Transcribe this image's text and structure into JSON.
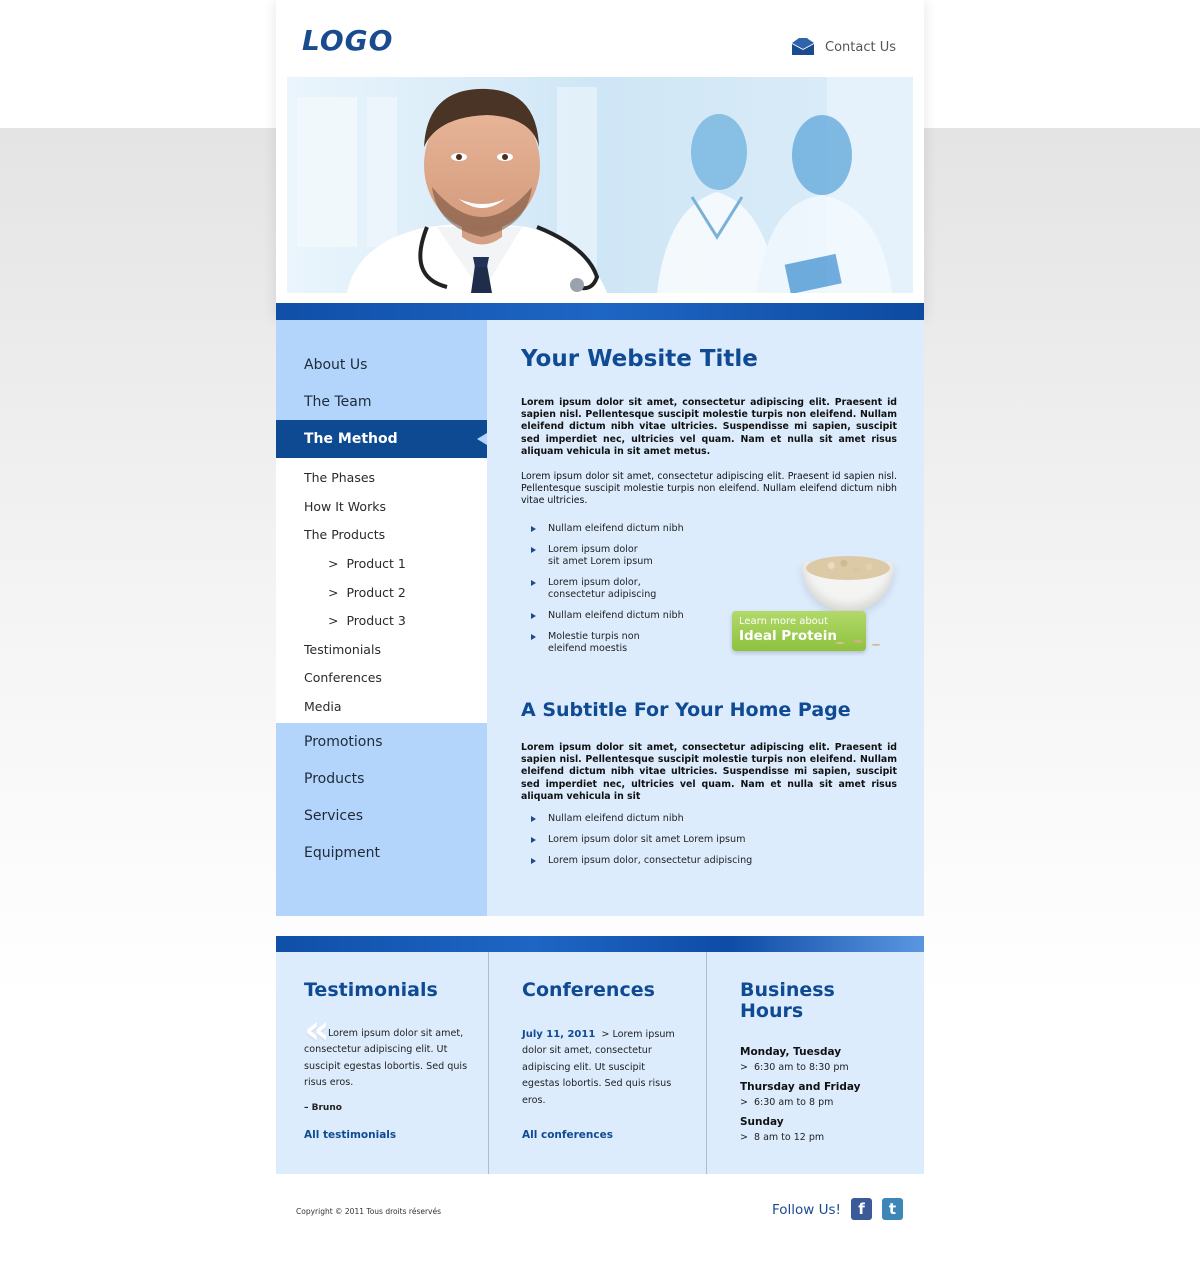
{
  "header": {
    "logo": "LOGO",
    "contact_label": "Contact Us"
  },
  "sidebar": {
    "top_items": [
      {
        "label": "About Us"
      },
      {
        "label": "The Team"
      }
    ],
    "active_item": {
      "label": "The Method"
    },
    "sub_items": [
      {
        "label": "The Phases"
      },
      {
        "label": "How It Works"
      },
      {
        "label": "The Products"
      },
      {
        "label": "Product 1",
        "prefix": ">"
      },
      {
        "label": "Product 2",
        "prefix": ">"
      },
      {
        "label": "Product 3",
        "prefix": ">"
      },
      {
        "label": "Testimonials"
      },
      {
        "label": "Conferences"
      },
      {
        "label": "Media"
      }
    ],
    "bottom_items": [
      {
        "label": "Promotions"
      },
      {
        "label": "Products"
      },
      {
        "label": "Services"
      },
      {
        "label": "Equipment"
      }
    ]
  },
  "main": {
    "title": "Your Website Title",
    "intro_bold": "Lorem ipsum dolor sit amet, consectetur adipiscing elit. Praesent id sapien nisl. Pellentesque suscipit molestie turpis non eleifend. Nullam eleifend dictum nibh vitae ultricies. Suspendisse mi sapien, suscipit sed imperdiet nec, ultricies vel quam. Nam et nulla sit amet risus aliquam vehicula in sit amet metus.",
    "intro": "Lorem ipsum dolor sit amet, consectetur adipiscing elit. Praesent id sapien nisl. Pellentesque suscipit molestie turpis non eleifend. Nullam eleifend dictum nibh vitae ultricies.",
    "bullets": [
      "Nullam eleifend dictum nibh",
      "Lorem ipsum dolor\nsit amet Lorem ipsum",
      "Lorem ipsum dolor,\nconsectetur adipiscing",
      "Nullam eleifend dictum nibh",
      "Molestie turpis non\neleifend moestis"
    ],
    "promo": {
      "line1": "Learn more about",
      "line2": "Ideal Protein"
    },
    "subtitle": "A Subtitle For Your Home Page",
    "sub_bold": "Lorem ipsum dolor sit amet, consectetur adipiscing elit. Praesent id sapien nisl. Pellentesque suscipit molestie turpis non eleifend. Nullam eleifend dictum nibh vitae ultricies. Suspendisse mi sapien, suscipit sed imperdiet nec, ultricies vel quam. Nam et nulla sit amet risus aliquam vehicula in sit",
    "sub_bullets": [
      "Nullam eleifend dictum nibh",
      "Lorem ipsum dolor sit amet Lorem ipsum",
      "Lorem ipsum dolor, consectetur adipiscing"
    ]
  },
  "footer": {
    "testimonials": {
      "title": "Testimonials",
      "quote_mark": "«",
      "text": "Lorem ipsum dolor sit amet, consectetur adipiscing elit. Ut suscipit egestas lobortis. Sed quis risus eros.",
      "author": "– Bruno",
      "link": "All testimonials"
    },
    "conferences": {
      "title": "Conferences",
      "date": "July 11, 2011",
      "text": "Lorem ipsum dolor sit amet, consectetur adipiscing elit. Ut suscipit egestas lobortis. Sed quis risus eros.",
      "link": "All conferences"
    },
    "hours": {
      "title": "Business Hours",
      "entries": [
        {
          "day": "Monday, Tuesday",
          "time": "6:30 am to 8:30 pm"
        },
        {
          "day": "Thursday and Friday",
          "time": "6:30 am to 8 pm"
        },
        {
          "day": "Sunday",
          "time": "8 am to 12 pm"
        }
      ]
    },
    "copyright": "Copyright © 2011 Tous droits réservés",
    "follow": "Follow Us!",
    "social": [
      {
        "icon": "facebook-icon",
        "glyph": "f",
        "color": "#3b5b98"
      },
      {
        "icon": "twitter-icon",
        "glyph": "t",
        "color": "#3d87b8"
      }
    ]
  },
  "colors": {
    "brand_blue": "#0f4a93",
    "sidebar_blue": "#b3d5fb",
    "content_blue": "#dcecfd",
    "promo_green": "#8ec23f"
  }
}
